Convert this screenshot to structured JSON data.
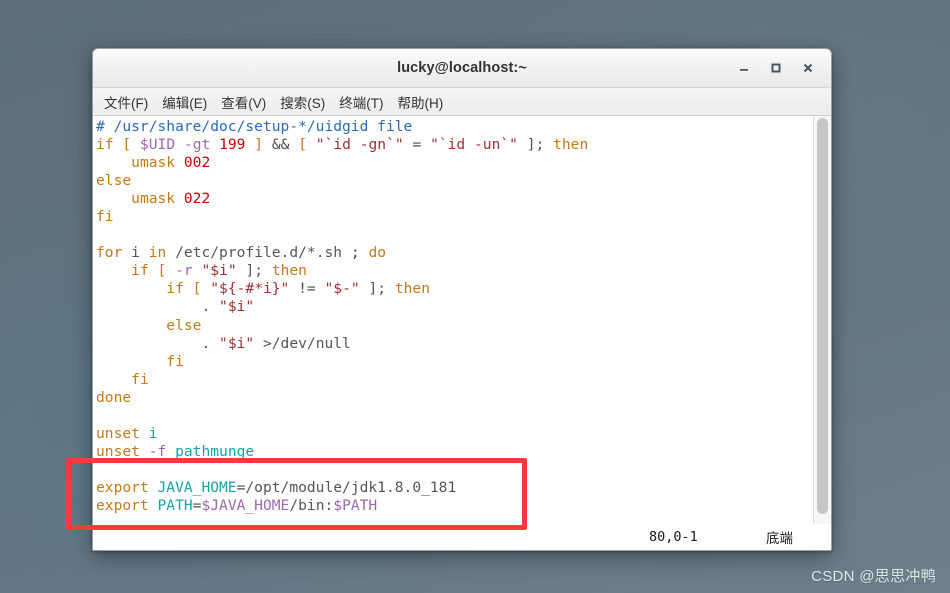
{
  "window": {
    "title": "lucky@localhost:~",
    "controls": [
      {
        "name": "minimize-button",
        "glyph": "–"
      },
      {
        "name": "maximize-button",
        "glyph": "□"
      },
      {
        "name": "close-button",
        "glyph": "✕"
      }
    ]
  },
  "menubar": {
    "items": [
      {
        "label": "文件(F)"
      },
      {
        "label": "编辑(E)"
      },
      {
        "label": "查看(V)"
      },
      {
        "label": "搜索(S)"
      },
      {
        "label": "终端(T)"
      },
      {
        "label": "帮助(H)"
      }
    ]
  },
  "terminal": {
    "lines": [
      "# /usr/share/doc/setup-*/uidgid file",
      "if [ $UID -gt 199 ] && [ \"`id -gn`\" = \"`id -un`\" ]; then",
      "    umask 002",
      "else",
      "    umask 022",
      "fi",
      "",
      "for i in /etc/profile.d/*.sh ; do",
      "    if [ -r \"$i\" ]; then",
      "        if [ \"${-#*i}\" != \"$-\" ]; then",
      "            . \"$i\"",
      "        else",
      "            . \"$i\" >/dev/null",
      "        fi",
      "    fi",
      "done",
      "",
      "unset i",
      "unset -f pathmunge",
      "",
      "export JAVA_HOME=/opt/module/jdk1.8.0_181",
      "export PATH=$JAVA_HOME/bin:$PATH"
    ]
  },
  "statusbar": {
    "position": "80,0-1",
    "state": "底端"
  },
  "annotation": {
    "box_color": "#f73b39"
  },
  "watermark": {
    "text": "CSDN @思思冲鸭"
  }
}
